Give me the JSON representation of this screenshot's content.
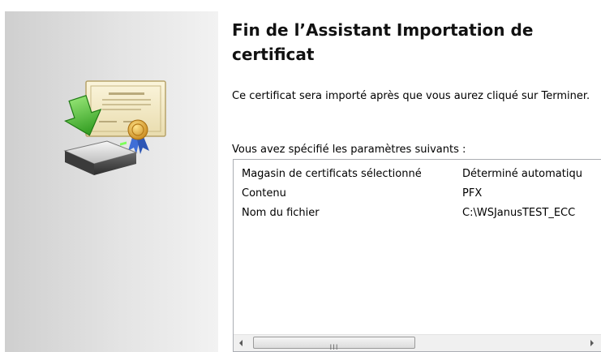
{
  "wizard": {
    "title": "Fin de l’Assistant Importation de certificat",
    "description": "Ce certificat sera importé après que vous aurez cliqué sur Terminer.",
    "params_label": "Vous avez spécifié les paramètres suivants :",
    "settings": [
      {
        "key": "Magasin de certificats sélectionné",
        "value": "Déterminé automatiqu"
      },
      {
        "key": "Contenu",
        "value": "PFX"
      },
      {
        "key": "Nom du fichier",
        "value": "C:\\WSJanusTEST_ECC"
      }
    ],
    "scrollbar_grip": "III"
  }
}
